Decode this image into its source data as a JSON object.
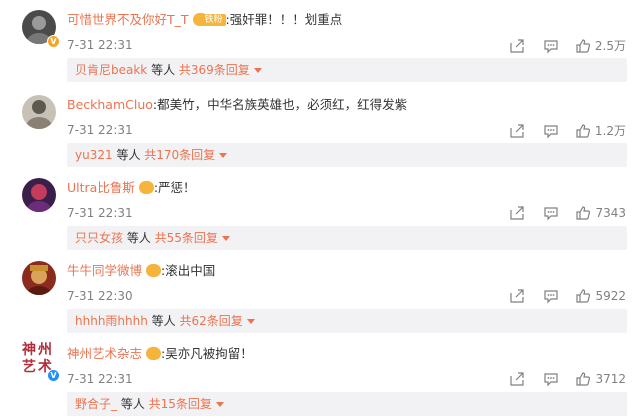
{
  "colors": {
    "username": "#eb7350",
    "meta": "#808080",
    "reply_bg": "#f2f2f5",
    "medal": "#f7b43d"
  },
  "icons": {
    "share": "share-icon",
    "reply": "comment-icon",
    "like": "thumbs-up-icon"
  },
  "comments": [
    {
      "username": "可惜世界不及你好T_T",
      "medal_label": "铁粉",
      "content": ":强奸罪！！！划重点",
      "time": "7-31 22:31",
      "likes": "2.5万",
      "reply_user": "贝肯尼beakk",
      "reply_mid": " 等人 ",
      "reply_more": "共369条回复"
    },
    {
      "username": "BeckhamCluo",
      "content": ":都美竹，中华名族英雄也，必须红，红得发紫",
      "time": "7-31 22:31",
      "likes": "1.2万",
      "reply_user": "yu321",
      "reply_mid": " 等人 ",
      "reply_more": "共170条回复"
    },
    {
      "username": "Ultra比鲁斯",
      "content": ":严惩！",
      "time": "7-31 22:31",
      "likes": "7343",
      "reply_user": "只只女孩",
      "reply_mid": " 等人 ",
      "reply_more": "共55条回复"
    },
    {
      "username": "牛牛同学微博",
      "content": ":滚出中国",
      "time": "7-31 22:30",
      "likes": "5922",
      "reply_user": "hhhh雨hhhh",
      "reply_mid": " 等人 ",
      "reply_more": "共62条回复"
    },
    {
      "username": "神州艺术杂志",
      "avatar_text": "神州艺术",
      "content": ":吴亦凡被拘留！",
      "time": "7-31 22:31",
      "likes": "3712",
      "reply_user": "野合子_",
      "reply_mid": " 等人 ",
      "reply_more": "共15条回复"
    }
  ]
}
